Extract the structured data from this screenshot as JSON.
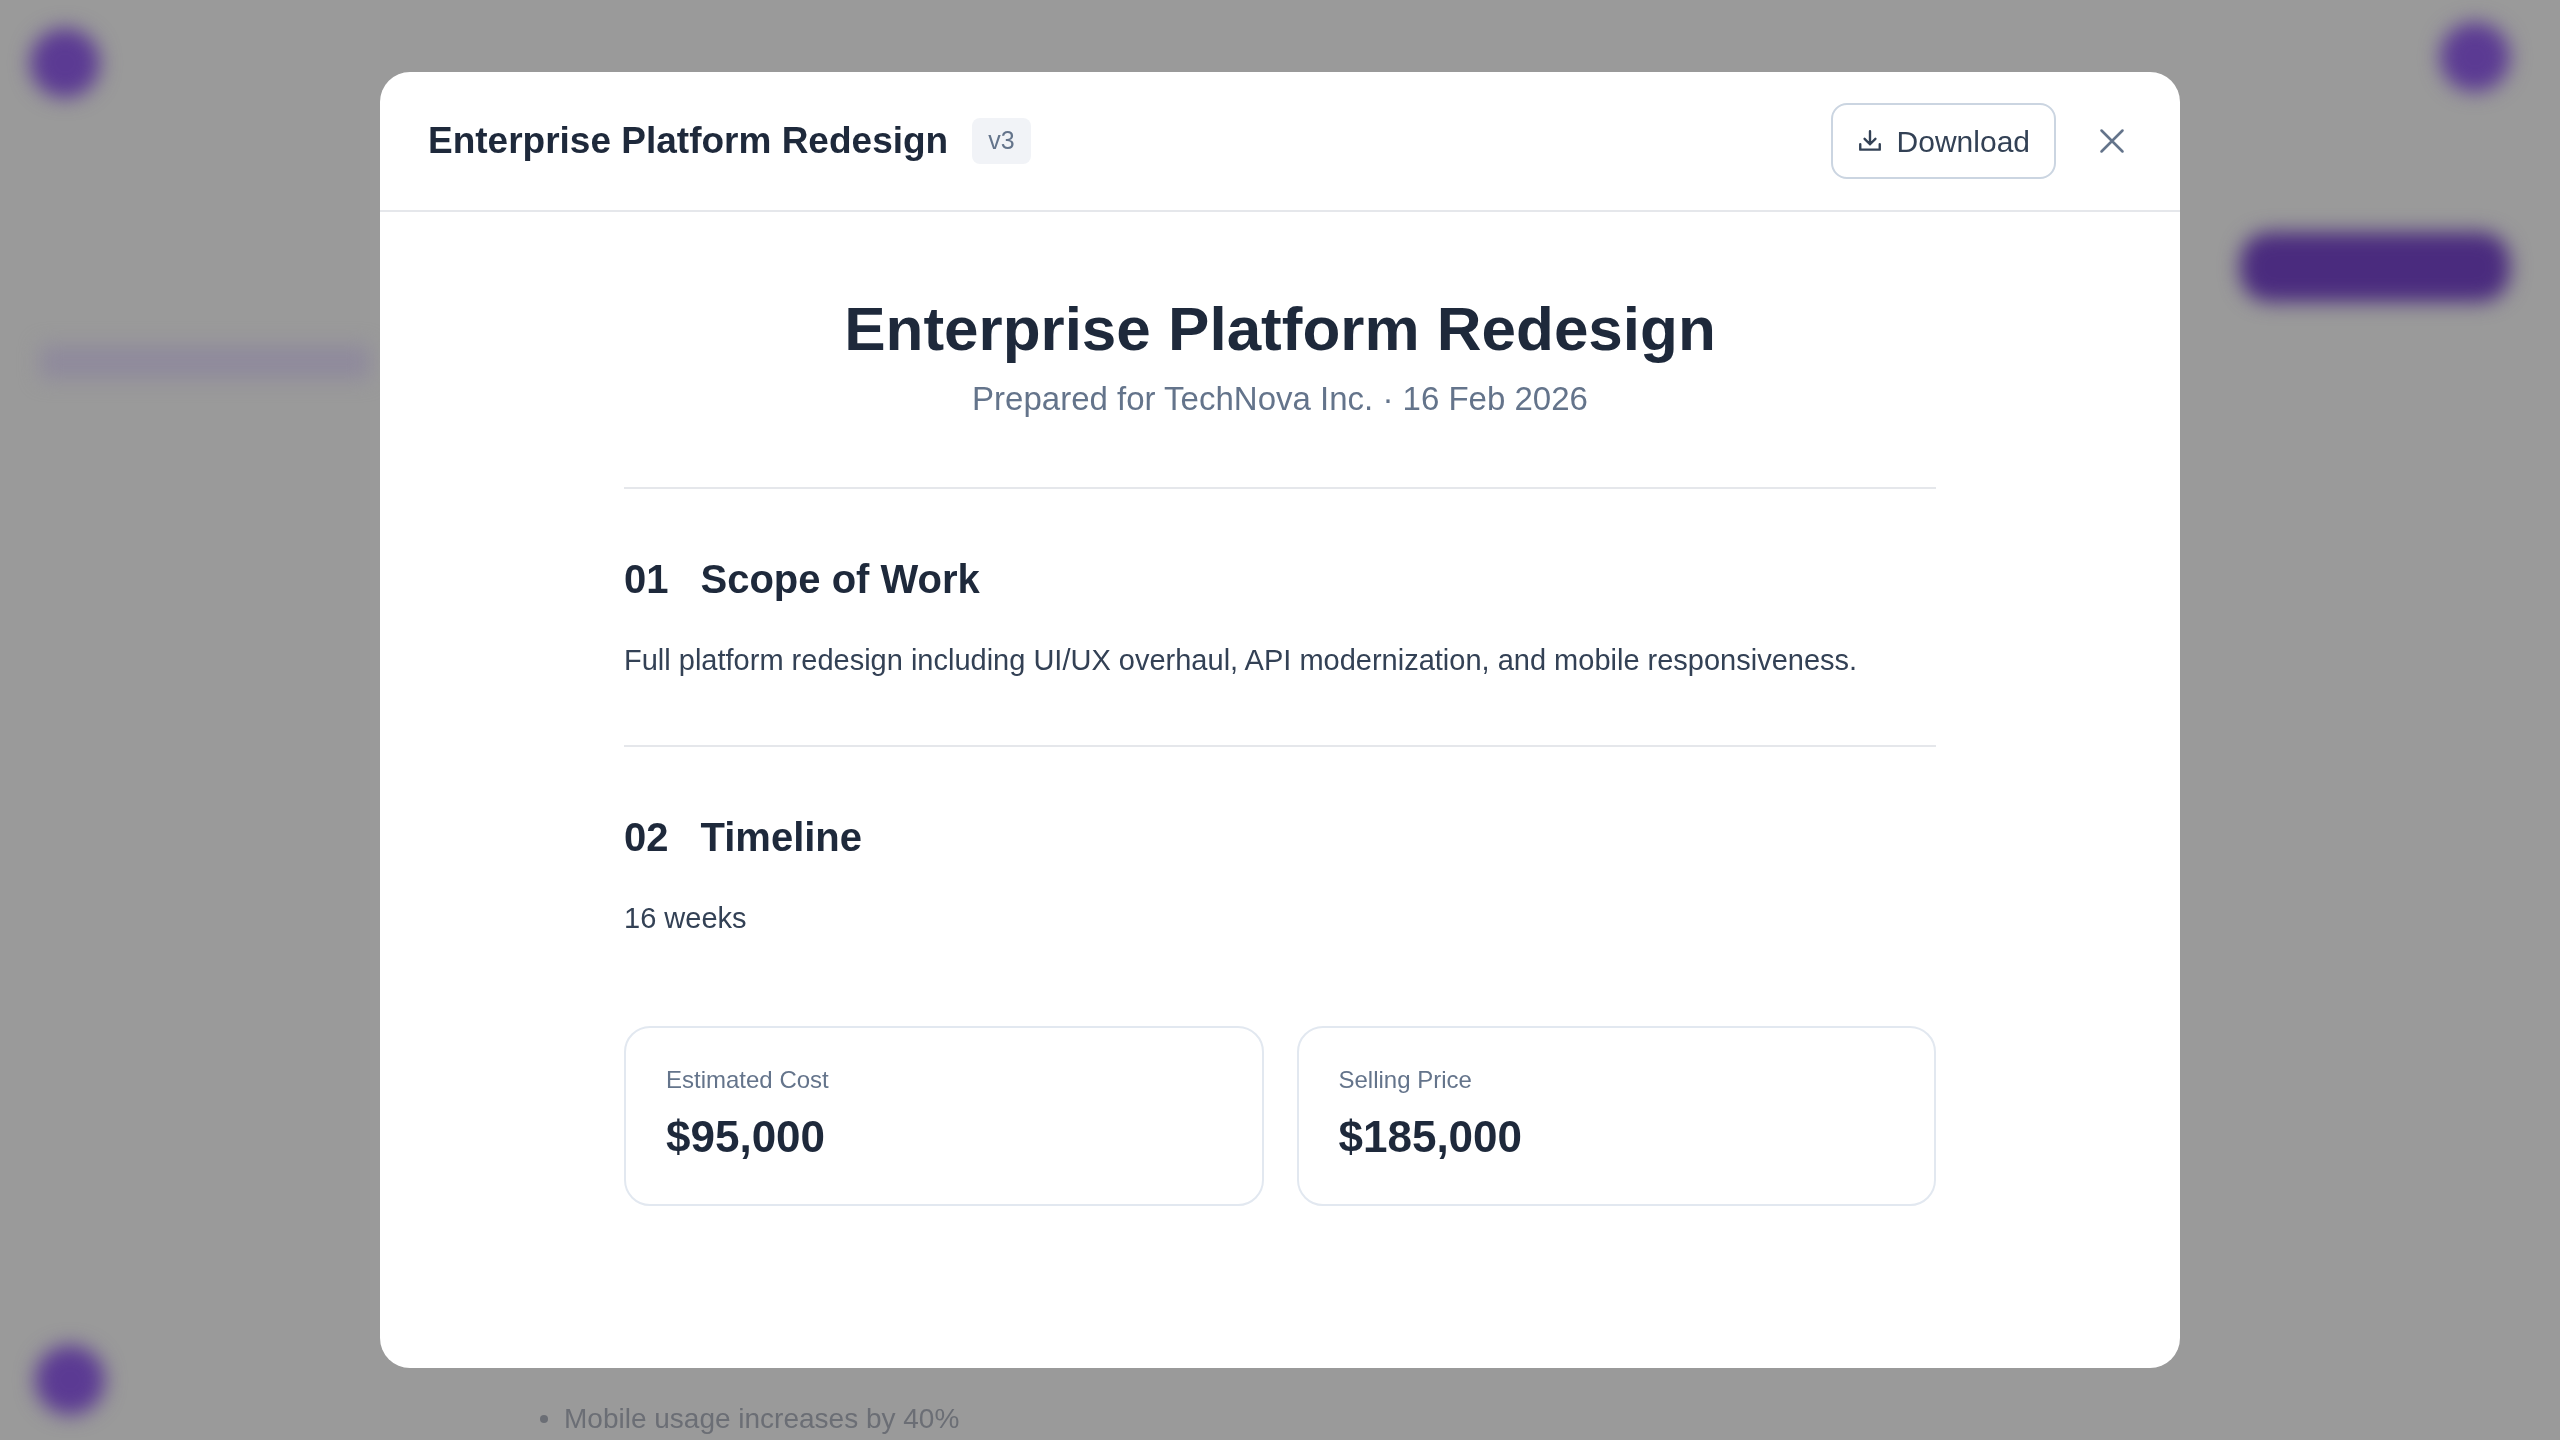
{
  "background": {
    "visible_text": "Mobile usage increases by 40%"
  },
  "modal": {
    "title": "Enterprise Platform Redesign",
    "version": "v3",
    "download_button": "Download",
    "document": {
      "title": "Enterprise Platform Redesign",
      "subtitle": "Prepared for TechNova Inc. · 16 Feb 2026",
      "sections": [
        {
          "number": "01",
          "heading": "Scope of Work",
          "body": "Full platform redesign including UI/UX overhaul, API modernization, and mobile responsiveness."
        },
        {
          "number": "02",
          "heading": "Timeline",
          "body": "16 weeks"
        }
      ],
      "cards": [
        {
          "label": "Estimated Cost",
          "value": "$95,000"
        },
        {
          "label": "Selling Price",
          "value": "$185,000"
        }
      ]
    }
  }
}
